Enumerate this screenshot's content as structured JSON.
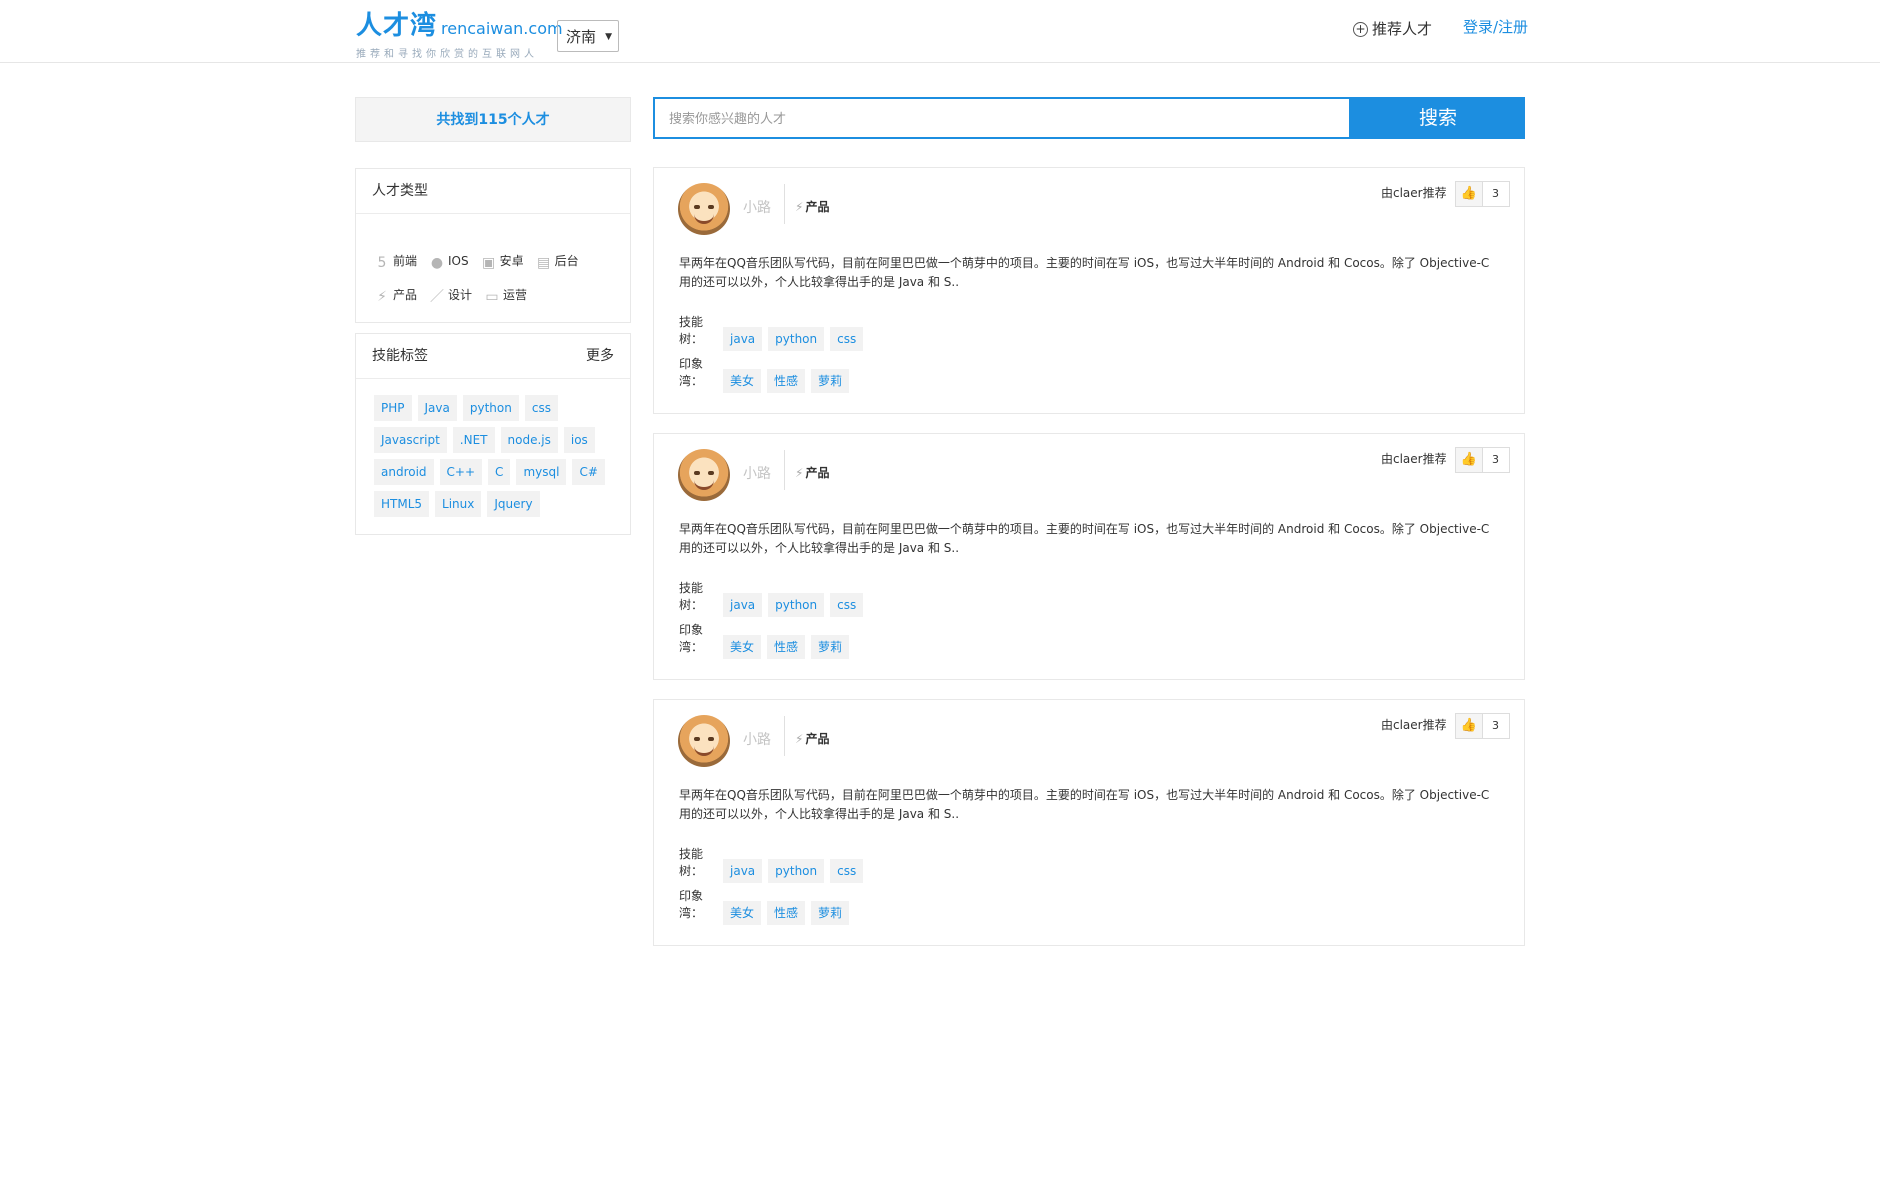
{
  "header": {
    "logo_cn": "人才湾",
    "logo_domain": "rencaiwan.com",
    "logo_slogan": "推荐和寻找你欣赏的互联网人",
    "city": "济南",
    "recommend_label": "推荐人才",
    "login_label": "登录/注册"
  },
  "sidebar": {
    "found_text": "共找到115个人才",
    "types_title": "人才类型",
    "types": [
      {
        "label": "前端",
        "icon": "html5-icon",
        "glyph": "5"
      },
      {
        "label": "IOS",
        "icon": "apple-icon",
        "glyph": "●"
      },
      {
        "label": "安卓",
        "icon": "android-icon",
        "glyph": "▣"
      },
      {
        "label": "后台",
        "icon": "server-icon",
        "glyph": "▤"
      },
      {
        "label": "产品",
        "icon": "bolt-icon",
        "glyph": "⚡"
      },
      {
        "label": "设计",
        "icon": "pen-icon",
        "glyph": "／"
      },
      {
        "label": "运营",
        "icon": "monitor-icon",
        "glyph": "▭"
      }
    ],
    "skills_title": "技能标签",
    "skills_more": "更多",
    "skills": [
      "PHP",
      "Java",
      "python",
      "css",
      "Javascript",
      ".NET",
      "node.js",
      "ios",
      "android",
      "C++",
      "C",
      "mysql",
      "C#",
      "HTML5",
      "Linux",
      "Jquery"
    ]
  },
  "search": {
    "placeholder": "搜索你感兴趣的人才",
    "button": "搜索"
  },
  "cards": [
    {
      "name": "小路",
      "category": "产品",
      "recommended_by": "由claer推荐",
      "likes": "3",
      "description": "早两年在QQ音乐团队写代码，目前在阿里巴巴做一个萌芽中的项目。主要的时间在写 iOS，也写过大半年时间的 Android 和 Cocos。除了 Objective-C 用的还可以以外，个人比较拿得出手的是 Java 和 S..",
      "skills_label": "技能树：",
      "skills": [
        "java",
        "python",
        "css"
      ],
      "impressions_label": "印象湾：",
      "impressions": [
        "美女",
        "性感",
        "萝莉"
      ]
    },
    {
      "name": "小路",
      "category": "产品",
      "recommended_by": "由claer推荐",
      "likes": "3",
      "description": "早两年在QQ音乐团队写代码，目前在阿里巴巴做一个萌芽中的项目。主要的时间在写 iOS，也写过大半年时间的 Android 和 Cocos。除了 Objective-C 用的还可以以外，个人比较拿得出手的是 Java 和 S..",
      "skills_label": "技能树：",
      "skills": [
        "java",
        "python",
        "css"
      ],
      "impressions_label": "印象湾：",
      "impressions": [
        "美女",
        "性感",
        "萝莉"
      ]
    },
    {
      "name": "小路",
      "category": "产品",
      "recommended_by": "由claer推荐",
      "likes": "3",
      "description": "早两年在QQ音乐团队写代码，目前在阿里巴巴做一个萌芽中的项目。主要的时间在写 iOS，也写过大半年时间的 Android 和 Cocos。除了 Objective-C 用的还可以以外，个人比较拿得出手的是 Java 和 S..",
      "skills_label": "技能树：",
      "skills": [
        "java",
        "python",
        "css"
      ],
      "impressions_label": "印象湾：",
      "impressions": [
        "美女",
        "性感",
        "萝莉"
      ]
    }
  ]
}
